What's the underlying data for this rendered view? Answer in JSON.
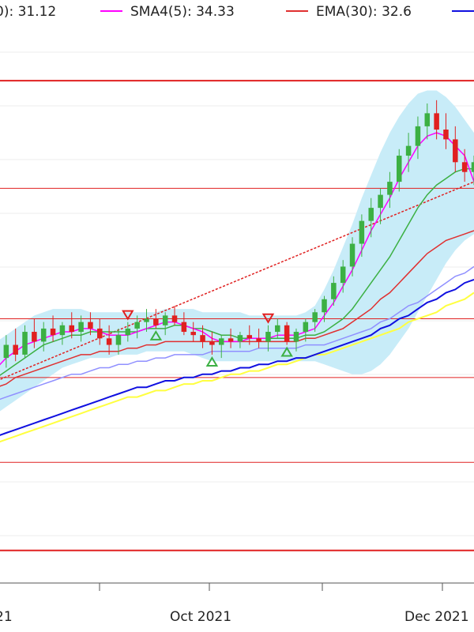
{
  "legend": [
    {
      "text": "0): 31.12",
      "color": "#3cb043"
    },
    {
      "text": "SMA4(5): 34.33",
      "color": "#ff00ff"
    },
    {
      "text": "EMA(30): 32.6",
      "color": "#e03030"
    },
    {
      "text": "",
      "color": "#1010e0"
    }
  ],
  "chart_data": {
    "type": "line",
    "x_tick_labels": [
      "21",
      "Oct 2021",
      "Dec 2021"
    ],
    "colors": {
      "up": "#3cb043",
      "down": "#e02020",
      "sma_short": "#3cb043",
      "sma_fast": "#ff00ff",
      "ema30": "#e03030",
      "ma_slow": "#1010e0",
      "ma_yellow": "#ffff40",
      "band": "#c8ecf8",
      "trend": "#e02020",
      "hline": "#e02020",
      "lower_ma": "#9090ff"
    },
    "candles": [
      {
        "o": 28.5,
        "h": 29.2,
        "l": 28.1,
        "c": 28.9
      },
      {
        "o": 28.9,
        "h": 29.6,
        "l": 28.6,
        "c": 29.3
      },
      {
        "o": 29.3,
        "h": 29.8,
        "l": 28.8,
        "c": 29.0
      },
      {
        "o": 29.0,
        "h": 29.9,
        "l": 28.9,
        "c": 29.7
      },
      {
        "o": 29.7,
        "h": 30.1,
        "l": 29.2,
        "c": 29.4
      },
      {
        "o": 29.4,
        "h": 30.0,
        "l": 29.1,
        "c": 29.8
      },
      {
        "o": 29.8,
        "h": 30.2,
        "l": 29.4,
        "c": 29.6
      },
      {
        "o": 29.6,
        "h": 30.0,
        "l": 29.3,
        "c": 29.9
      },
      {
        "o": 29.9,
        "h": 30.3,
        "l": 29.5,
        "c": 29.7
      },
      {
        "o": 29.7,
        "h": 30.2,
        "l": 29.4,
        "c": 30.0
      },
      {
        "o": 30.0,
        "h": 30.3,
        "l": 29.6,
        "c": 29.8
      },
      {
        "o": 29.8,
        "h": 30.1,
        "l": 29.3,
        "c": 29.5
      },
      {
        "o": 29.5,
        "h": 29.9,
        "l": 29.0,
        "c": 29.3
      },
      {
        "o": 29.3,
        "h": 29.8,
        "l": 29.0,
        "c": 29.6
      },
      {
        "o": 29.6,
        "h": 30.0,
        "l": 29.4,
        "c": 29.8
      },
      {
        "o": 29.8,
        "h": 30.2,
        "l": 29.5,
        "c": 30.0
      },
      {
        "o": 30.0,
        "h": 30.4,
        "l": 29.7,
        "c": 30.1
      },
      {
        "o": 30.1,
        "h": 30.4,
        "l": 29.8,
        "c": 29.9
      },
      {
        "o": 29.9,
        "h": 30.3,
        "l": 29.6,
        "c": 30.2
      },
      {
        "o": 30.2,
        "h": 30.5,
        "l": 29.9,
        "c": 30.0
      },
      {
        "o": 30.0,
        "h": 30.3,
        "l": 29.6,
        "c": 29.7
      },
      {
        "o": 29.7,
        "h": 30.0,
        "l": 29.4,
        "c": 29.6
      },
      {
        "o": 29.6,
        "h": 29.9,
        "l": 29.2,
        "c": 29.4
      },
      {
        "o": 29.4,
        "h": 29.7,
        "l": 29.0,
        "c": 29.3
      },
      {
        "o": 29.3,
        "h": 29.6,
        "l": 28.9,
        "c": 29.5
      },
      {
        "o": 29.5,
        "h": 29.8,
        "l": 29.2,
        "c": 29.4
      },
      {
        "o": 29.4,
        "h": 29.7,
        "l": 29.2,
        "c": 29.6
      },
      {
        "o": 29.6,
        "h": 29.9,
        "l": 29.3,
        "c": 29.5
      },
      {
        "o": 29.5,
        "h": 29.8,
        "l": 29.2,
        "c": 29.4
      },
      {
        "o": 29.4,
        "h": 29.9,
        "l": 29.1,
        "c": 29.7
      },
      {
        "o": 29.7,
        "h": 30.1,
        "l": 29.5,
        "c": 29.9
      },
      {
        "o": 29.9,
        "h": 30.0,
        "l": 29.3,
        "c": 29.4
      },
      {
        "o": 29.4,
        "h": 29.8,
        "l": 29.1,
        "c": 29.7
      },
      {
        "o": 29.7,
        "h": 30.1,
        "l": 29.4,
        "c": 30.0
      },
      {
        "o": 30.0,
        "h": 30.4,
        "l": 29.7,
        "c": 30.3
      },
      {
        "o": 30.3,
        "h": 30.8,
        "l": 30.0,
        "c": 30.7
      },
      {
        "o": 30.7,
        "h": 31.4,
        "l": 30.5,
        "c": 31.2
      },
      {
        "o": 31.2,
        "h": 31.9,
        "l": 30.9,
        "c": 31.7
      },
      {
        "o": 31.7,
        "h": 32.6,
        "l": 31.4,
        "c": 32.4
      },
      {
        "o": 32.4,
        "h": 33.3,
        "l": 32.0,
        "c": 33.1
      },
      {
        "o": 33.1,
        "h": 33.8,
        "l": 32.6,
        "c": 33.5
      },
      {
        "o": 33.5,
        "h": 34.1,
        "l": 33.0,
        "c": 33.9
      },
      {
        "o": 33.9,
        "h": 34.6,
        "l": 33.5,
        "c": 34.3
      },
      {
        "o": 34.3,
        "h": 35.3,
        "l": 34.0,
        "c": 35.1
      },
      {
        "o": 35.1,
        "h": 35.8,
        "l": 34.6,
        "c": 35.4
      },
      {
        "o": 35.4,
        "h": 36.3,
        "l": 35.0,
        "c": 36.0
      },
      {
        "o": 36.0,
        "h": 36.7,
        "l": 35.6,
        "c": 36.4
      },
      {
        "o": 36.4,
        "h": 36.8,
        "l": 35.6,
        "c": 35.9
      },
      {
        "o": 35.9,
        "h": 36.4,
        "l": 35.3,
        "c": 35.6
      },
      {
        "o": 35.6,
        "h": 36.0,
        "l": 34.6,
        "c": 34.9
      },
      {
        "o": 34.9,
        "h": 35.3,
        "l": 34.3,
        "c": 34.6
      },
      {
        "o": 34.6,
        "h": 35.1,
        "l": 34.2,
        "c": 34.9
      }
    ],
    "sma_fast": [
      28.6,
      28.9,
      29.1,
      29.3,
      29.4,
      29.5,
      29.6,
      29.7,
      29.7,
      29.8,
      29.8,
      29.7,
      29.6,
      29.6,
      29.6,
      29.7,
      29.8,
      29.9,
      30.0,
      30.0,
      29.9,
      29.8,
      29.7,
      29.5,
      29.4,
      29.4,
      29.4,
      29.5,
      29.5,
      29.5,
      29.6,
      29.6,
      29.6,
      29.7,
      29.8,
      30.2,
      30.6,
      31.1,
      31.6,
      32.2,
      32.8,
      33.3,
      33.8,
      34.4,
      34.9,
      35.4,
      35.7,
      35.8,
      35.7,
      35.4,
      35.1,
      34.3
    ],
    "sma_short": [
      28.3,
      28.5,
      28.7,
      28.9,
      29.1,
      29.3,
      29.4,
      29.5,
      29.6,
      29.6,
      29.7,
      29.7,
      29.7,
      29.7,
      29.7,
      29.7,
      29.8,
      29.8,
      29.8,
      29.9,
      29.9,
      29.8,
      29.8,
      29.7,
      29.6,
      29.6,
      29.5,
      29.5,
      29.5,
      29.5,
      29.5,
      29.5,
      29.5,
      29.6,
      29.6,
      29.7,
      29.9,
      30.1,
      30.4,
      30.8,
      31.2,
      31.6,
      32.0,
      32.5,
      33.0,
      33.5,
      33.9,
      34.2,
      34.4,
      34.6,
      34.7,
      34.7
    ],
    "ema30": [
      28.0,
      28.1,
      28.3,
      28.4,
      28.5,
      28.6,
      28.7,
      28.8,
      28.9,
      29.0,
      29.0,
      29.1,
      29.1,
      29.1,
      29.2,
      29.2,
      29.3,
      29.3,
      29.4,
      29.4,
      29.4,
      29.4,
      29.4,
      29.4,
      29.4,
      29.4,
      29.4,
      29.4,
      29.4,
      29.4,
      29.4,
      29.4,
      29.4,
      29.5,
      29.5,
      29.6,
      29.7,
      29.8,
      30.0,
      30.2,
      30.4,
      30.7,
      30.9,
      31.2,
      31.5,
      31.8,
      32.1,
      32.3,
      32.5,
      32.6,
      32.7,
      32.8
    ],
    "lower_ma": [
      27.6,
      27.7,
      27.8,
      27.9,
      28.0,
      28.1,
      28.2,
      28.3,
      28.4,
      28.4,
      28.5,
      28.6,
      28.6,
      28.7,
      28.7,
      28.8,
      28.8,
      28.9,
      28.9,
      29.0,
      29.0,
      29.0,
      29.0,
      29.1,
      29.1,
      29.1,
      29.1,
      29.1,
      29.2,
      29.2,
      29.2,
      29.2,
      29.2,
      29.3,
      29.3,
      29.3,
      29.4,
      29.5,
      29.6,
      29.7,
      29.8,
      30.0,
      30.1,
      30.3,
      30.5,
      30.6,
      30.8,
      31.0,
      31.2,
      31.4,
      31.5,
      31.7
    ],
    "ma_slow": [
      26.5,
      26.6,
      26.7,
      26.8,
      26.9,
      27.0,
      27.1,
      27.2,
      27.3,
      27.4,
      27.5,
      27.6,
      27.7,
      27.8,
      27.9,
      28.0,
      28.0,
      28.1,
      28.2,
      28.2,
      28.3,
      28.3,
      28.4,
      28.4,
      28.5,
      28.5,
      28.6,
      28.6,
      28.7,
      28.7,
      28.8,
      28.8,
      28.9,
      28.9,
      29.0,
      29.1,
      29.2,
      29.3,
      29.4,
      29.5,
      29.6,
      29.8,
      29.9,
      30.1,
      30.2,
      30.4,
      30.6,
      30.7,
      30.9,
      31.0,
      31.2,
      31.3
    ],
    "ma_yellow": [
      26.3,
      26.4,
      26.5,
      26.6,
      26.7,
      26.8,
      26.9,
      27.0,
      27.1,
      27.2,
      27.3,
      27.4,
      27.5,
      27.6,
      27.7,
      27.7,
      27.8,
      27.9,
      27.9,
      28.0,
      28.1,
      28.1,
      28.2,
      28.2,
      28.3,
      28.4,
      28.4,
      28.5,
      28.5,
      28.6,
      28.7,
      28.7,
      28.8,
      28.9,
      29.0,
      29.0,
      29.1,
      29.2,
      29.3,
      29.4,
      29.5,
      29.6,
      29.7,
      29.8,
      30.0,
      30.1,
      30.2,
      30.3,
      30.5,
      30.6,
      30.7,
      30.9
    ],
    "band_upper": [
      29.4,
      29.6,
      29.8,
      30.0,
      30.2,
      30.3,
      30.4,
      30.4,
      30.4,
      30.4,
      30.3,
      30.3,
      30.3,
      30.3,
      30.3,
      30.3,
      30.3,
      30.3,
      30.4,
      30.4,
      30.4,
      30.4,
      30.3,
      30.3,
      30.3,
      30.3,
      30.3,
      30.2,
      30.2,
      30.2,
      30.2,
      30.2,
      30.2,
      30.3,
      30.5,
      31.0,
      31.6,
      32.3,
      33.0,
      33.8,
      34.5,
      35.2,
      35.8,
      36.3,
      36.7,
      37.0,
      37.1,
      37.1,
      36.9,
      36.6,
      36.2,
      35.8
    ],
    "band_lower": [
      27.2,
      27.4,
      27.6,
      27.8,
      28.0,
      28.2,
      28.4,
      28.6,
      28.7,
      28.8,
      28.9,
      28.9,
      28.9,
      29.0,
      29.0,
      29.0,
      29.1,
      29.1,
      29.1,
      29.1,
      29.1,
      29.0,
      28.9,
      28.8,
      28.8,
      28.8,
      28.8,
      28.8,
      28.8,
      28.8,
      28.8,
      28.8,
      28.8,
      28.8,
      28.8,
      28.7,
      28.6,
      28.5,
      28.4,
      28.4,
      28.5,
      28.7,
      29.0,
      29.4,
      29.8,
      30.3,
      30.8,
      31.3,
      31.8,
      32.2,
      32.5,
      32.7
    ],
    "horizontal_levels": [
      37.4,
      34.1,
      30.1,
      28.3,
      25.7,
      23.0
    ],
    "trend_line": {
      "from_index": 0,
      "from_value": 28.2,
      "to_index": 51,
      "to_value": 34.3
    },
    "signal_markers": [
      {
        "index": 17,
        "kind": "buy"
      },
      {
        "index": 23,
        "kind": "buy"
      },
      {
        "index": 31,
        "kind": "buy"
      },
      {
        "index": 14,
        "kind": "sell"
      },
      {
        "index": 29,
        "kind": "sell"
      }
    ]
  }
}
